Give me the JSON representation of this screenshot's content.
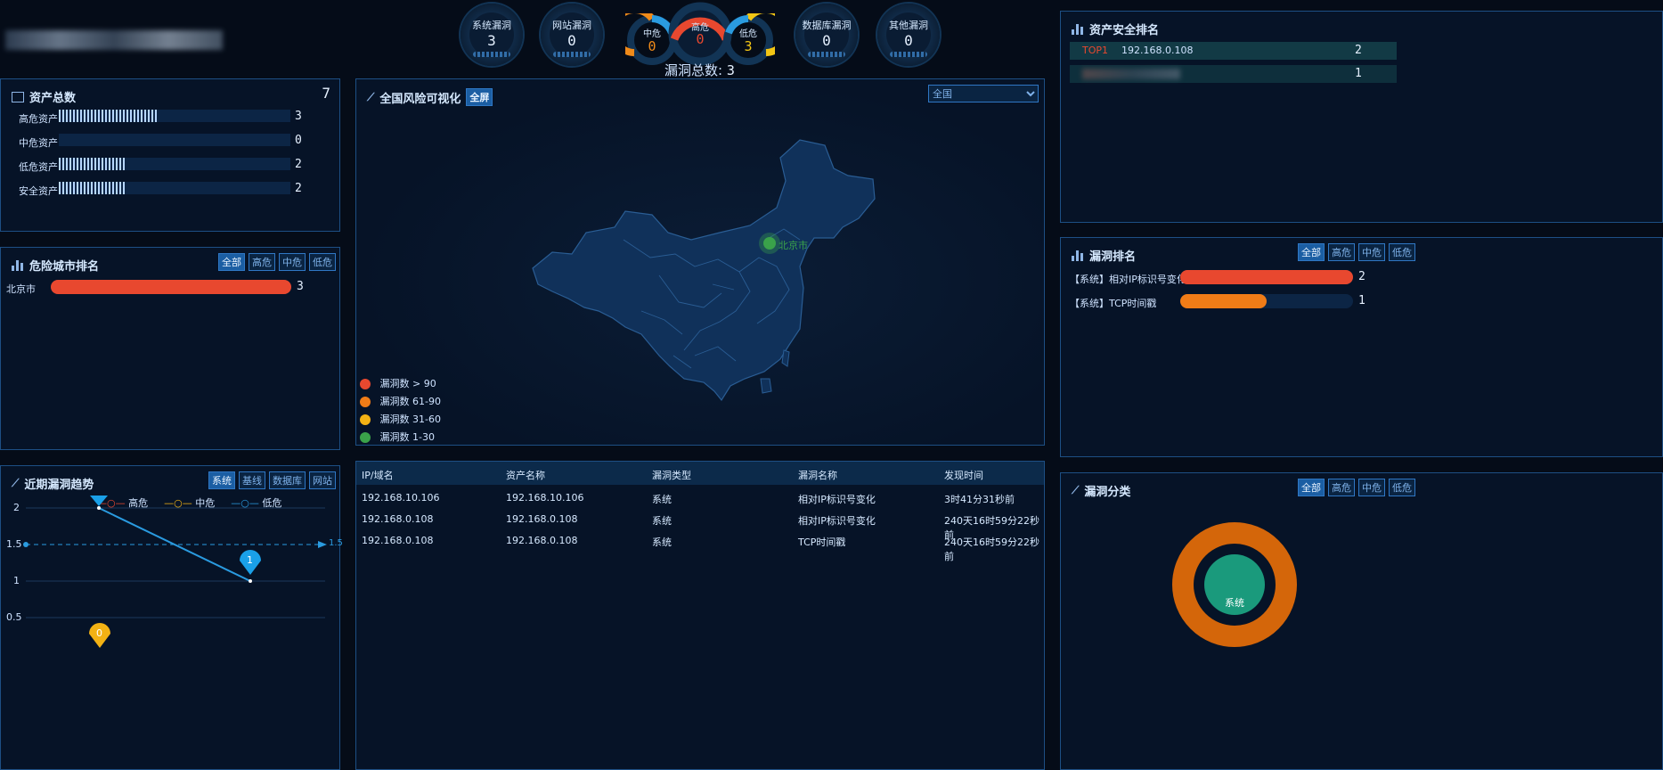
{
  "app": {
    "title_blur": ""
  },
  "gauges": {
    "system": {
      "label": "系统漏洞",
      "value": "3"
    },
    "website": {
      "label": "网站漏洞",
      "value": "0"
    },
    "medium": {
      "label": "中危",
      "value": "0"
    },
    "high": {
      "label": "高危",
      "value": "0"
    },
    "low": {
      "label": "低危",
      "value": "3"
    },
    "database": {
      "label": "数据库漏洞",
      "value": "0"
    },
    "other": {
      "label": "其他漏洞",
      "value": "0"
    },
    "total_label": "漏洞总数:",
    "total_value": "3"
  },
  "assets_panel": {
    "title": "资产总数",
    "total": "7",
    "rows": [
      {
        "label": "高危资产",
        "value": "3",
        "fraction": 0.43
      },
      {
        "label": "中危资产",
        "value": "0",
        "fraction": 0
      },
      {
        "label": "低危资产",
        "value": "2",
        "fraction": 0.29
      },
      {
        "label": "安全资产",
        "value": "2",
        "fraction": 0.29
      }
    ]
  },
  "city_panel": {
    "title": "危险城市排名",
    "buttons": [
      "全部",
      "高危",
      "中危",
      "低危"
    ],
    "rows": [
      {
        "label": "北京市",
        "value": "3",
        "fraction": 1.0
      }
    ]
  },
  "trend_panel": {
    "title": "近期漏洞趋势",
    "buttons": [
      "系统",
      "基线",
      "数据库",
      "网站"
    ],
    "legend": [
      "高危",
      "中危",
      "低危"
    ],
    "y_ticks": [
      "2",
      "1.5",
      "1",
      "0.5"
    ],
    "avg_label": "1.5",
    "marker_1": "1",
    "marker_0": "0"
  },
  "map_panel": {
    "title": "全国风险可视化",
    "fullscreen_label": "全屏",
    "region_select": "全国",
    "city_label": "北京市",
    "legend": [
      {
        "label": "漏洞数 > 90",
        "color": "#e8482f"
      },
      {
        "label": "漏洞数 61-90",
        "color": "#f07c17"
      },
      {
        "label": "漏洞数 31-60",
        "color": "#f3b214"
      },
      {
        "label": "漏洞数 1-30",
        "color": "#3aa24a"
      }
    ]
  },
  "table": {
    "headers": [
      "IP/域名",
      "资产名称",
      "漏洞类型",
      "漏洞名称",
      "发现时间"
    ],
    "rows": [
      [
        "192.168.10.106",
        "192.168.10.106",
        "系统",
        "相对IP标识号变化",
        "3时41分31秒前"
      ],
      [
        "192.168.0.108",
        "192.168.0.108",
        "系统",
        "相对IP标识号变化",
        "240天16时59分22秒前"
      ],
      [
        "192.168.0.108",
        "192.168.0.108",
        "系统",
        "TCP时间戳",
        "240天16时59分22秒前"
      ]
    ]
  },
  "asset_rank": {
    "title": "资产安全排名",
    "rows": [
      {
        "rank": "TOP1",
        "ip": "192.168.0.108",
        "value": "2"
      },
      {
        "rank": "",
        "ip": "",
        "value": "1"
      }
    ]
  },
  "vuln_rank": {
    "title": "漏洞排名",
    "buttons": [
      "全部",
      "高危",
      "中危",
      "低危"
    ],
    "rows": [
      {
        "label": "【系统】相对IP标识号变化",
        "value": "2",
        "fraction": 1.0,
        "color": "#e8482f"
      },
      {
        "label": "【系统】TCP时间戳",
        "value": "1",
        "fraction": 0.5,
        "color": "#f07c17"
      }
    ]
  },
  "vuln_class": {
    "title": "漏洞分类",
    "buttons": [
      "全部",
      "高危",
      "中危",
      "低危"
    ],
    "donut_label": "系统"
  }
}
